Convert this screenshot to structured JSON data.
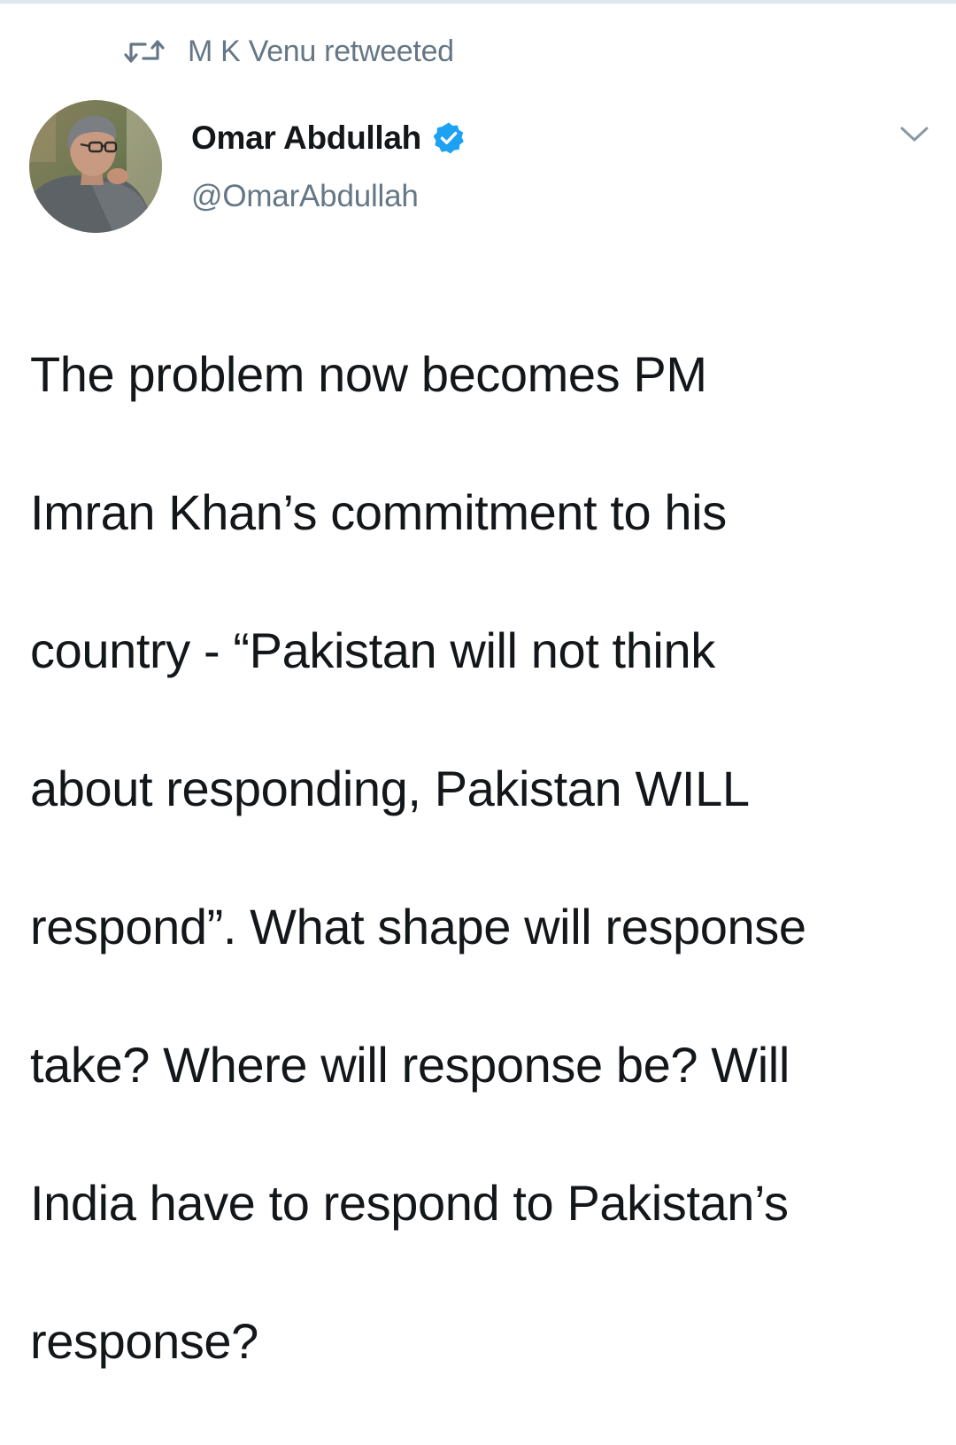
{
  "retweet": {
    "icon": "retweet-icon",
    "label": "M K Venu retweeted"
  },
  "author": {
    "display_name": "Omar Abdullah",
    "verified": true,
    "verified_icon": "verified-badge-icon",
    "handle": "@OmarAbdullah",
    "avatar_icon": "avatar"
  },
  "menu": {
    "icon": "chevron-down-icon"
  },
  "tweet": {
    "lines": [
      "The problem now becomes PM",
      "Imran Khan’s commitment to his",
      "country - “Pakistan will not think",
      "about responding, Pakistan WILL",
      "respond”. What shape will response",
      "take? Where will response be? Will",
      "India have to respond to Pakistan’s",
      "response?"
    ]
  },
  "colors": {
    "primary_text": "#14171a",
    "secondary_text": "#657786",
    "verified_blue": "#1da1f2",
    "divider": "#e1e8ed"
  }
}
